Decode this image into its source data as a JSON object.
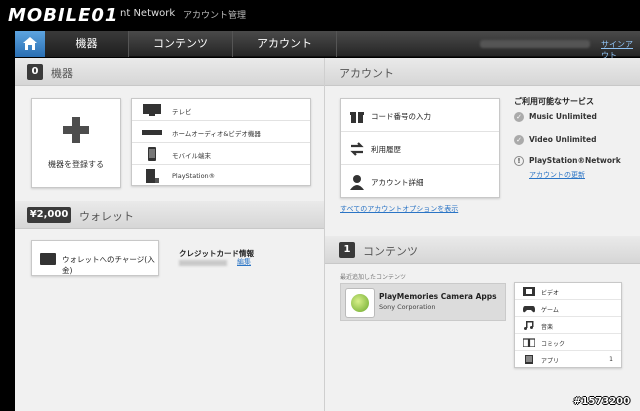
{
  "topbar": {
    "logo_text": "MOBILE01",
    "logo_tag": "nt Network",
    "page_title": "アカウント管理"
  },
  "nav": {
    "tabs": [
      {
        "label": "機器"
      },
      {
        "label": "コンテンツ"
      },
      {
        "label": "アカウント"
      }
    ],
    "signout_label": "サインアウト"
  },
  "devices": {
    "count": "0",
    "title": "機器",
    "register_label": "機器を登録する",
    "items": [
      {
        "label": "テレビ",
        "icon": "tv-icon"
      },
      {
        "label": "ホームオーディオ&ビデオ機器",
        "icon": "audio-device-icon"
      },
      {
        "label": "モバイル端末",
        "icon": "mobile-icon"
      },
      {
        "label": "PlayStation®",
        "icon": "playstation-icon"
      }
    ]
  },
  "wallet": {
    "amount": "¥2,000",
    "title": "ウォレット",
    "charge_label": "ウォレットへのチャージ(入金)",
    "credit_title": "クレジットカード情報",
    "edit_label": "編集"
  },
  "account": {
    "title": "アカウント",
    "items": [
      {
        "label": "コード番号の入力",
        "icon": "gift-icon"
      },
      {
        "label": "利用履歴",
        "icon": "arrows-icon"
      },
      {
        "label": "アカウント詳細",
        "icon": "person-icon"
      }
    ],
    "all_options_link": "すべてのアカウントオプションを表示",
    "services_title": "ご利用可能なサービス",
    "services": [
      {
        "label": "Music Unlimited"
      },
      {
        "label": "Video Unlimited"
      },
      {
        "label": "PlayStation®Network"
      }
    ],
    "update_link": "アカウントの更新"
  },
  "contents": {
    "count": "1",
    "title": "コンテンツ",
    "recent_label": "最近追加したコンテンツ",
    "recent_app": {
      "title": "PlayMemories Camera Apps",
      "publisher": "Sony Corporation"
    },
    "categories": [
      {
        "label": "ビデオ",
        "count": "",
        "icon": "film-icon"
      },
      {
        "label": "ゲーム",
        "count": "",
        "icon": "gamepad-icon"
      },
      {
        "label": "音楽",
        "count": "",
        "icon": "music-note-icon"
      },
      {
        "label": "コミック",
        "count": "",
        "icon": "book-icon"
      },
      {
        "label": "アプリ",
        "count": "1",
        "icon": "app-icon"
      }
    ]
  },
  "watermark": "#1573200",
  "colors": {
    "accent": "#2a74c5",
    "nav_bg": "#262626",
    "home_blue": "#3b86cf"
  }
}
